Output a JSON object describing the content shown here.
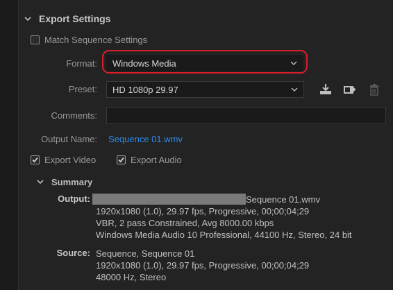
{
  "section": {
    "title": "Export Settings"
  },
  "match_sequence": {
    "label": "Match Sequence Settings",
    "checked": false
  },
  "format": {
    "label": "Format:",
    "value": "Windows Media"
  },
  "preset": {
    "label": "Preset:",
    "value": "HD 1080p 29.97"
  },
  "comments": {
    "label": "Comments:",
    "value": ""
  },
  "output_name": {
    "label": "Output Name:",
    "value": "Sequence 01.wmv"
  },
  "export_video": {
    "label": "Export Video",
    "checked": true
  },
  "export_audio": {
    "label": "Export Audio",
    "checked": true
  },
  "summary": {
    "title": "Summary",
    "output": {
      "label": "Output:",
      "filename": "Sequence 01.wmv",
      "lines": [
        "1920x1080 (1.0), 29.97 fps, Progressive, 00;00;04;29",
        "VBR, 2 pass Constrained, Avg 8000.00 kbps",
        "Windows Media Audio 10 Professional, 44100 Hz, Stereo, 24 bit"
      ]
    },
    "source": {
      "label": "Source:",
      "lines": [
        "Sequence, Sequence 01",
        "1920x1080 (1.0), 29.97 fps, Progressive, 00;00;04;29",
        "48000 Hz, Stereo"
      ]
    }
  },
  "icons": {
    "save_preset": "save-preset-icon",
    "import_preset": "import-preset-icon",
    "delete_preset": "trash-icon"
  },
  "colors": {
    "accent_link": "#2d8ceb",
    "highlight": "#d61f2a",
    "background": "#232323"
  }
}
